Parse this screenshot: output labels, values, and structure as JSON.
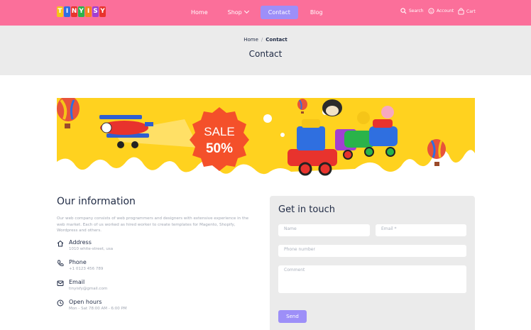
{
  "brand": {
    "logo_letters": [
      "T",
      "I",
      "N",
      "Y",
      "I",
      "S",
      "Y"
    ],
    "logo_colors": [
      "#f5c518",
      "#2f6fe0",
      "#e8332d",
      "#2ab34a",
      "#f58220",
      "#a23fd1",
      "#e8332d"
    ]
  },
  "nav": {
    "items": [
      {
        "label": "Home"
      },
      {
        "label": "Shop"
      },
      {
        "label": "Contact"
      },
      {
        "label": "Blog"
      }
    ],
    "active_index": 2
  },
  "utilities": {
    "search": "Search",
    "account": "Account",
    "cart": "Cart"
  },
  "breadcrumb": {
    "home": "Home",
    "separator": "/",
    "current": "Contact"
  },
  "page_title": "Contact",
  "banner": {
    "sale_word": "SALE",
    "sale_percent": "50%"
  },
  "info": {
    "title": "Our information",
    "description": "Our web company consists of web programmers and designers with extensive experience in the web market. Each of us worked as hired worker to create templates for Magento, Shopify, Wordpress and others.",
    "rows": [
      {
        "label": "Address",
        "value": "1010 white-street, usa",
        "icon": "home-icon"
      },
      {
        "label": "Phone",
        "value": "+1 0123 456 789",
        "icon": "phone-icon"
      },
      {
        "label": "Email",
        "value": "tinyisfy@gmail.com",
        "icon": "mail-icon"
      },
      {
        "label": "Open hours",
        "value": "Mon - Sat 78:00 AM - 6:00 PM",
        "icon": "clock-icon"
      }
    ]
  },
  "form": {
    "title": "Get in touch",
    "name_placeholder": "Name",
    "email_placeholder": "Email *",
    "phone_placeholder": "Phone number",
    "comment_placeholder": "Comment",
    "send_label": "Send"
  },
  "colors": {
    "header": "#fb6f9a",
    "accent": "#9d8ff8",
    "band": "#ebebeb",
    "banner_yellow": "#ffd21f",
    "sale_badge": "#f4502a"
  }
}
